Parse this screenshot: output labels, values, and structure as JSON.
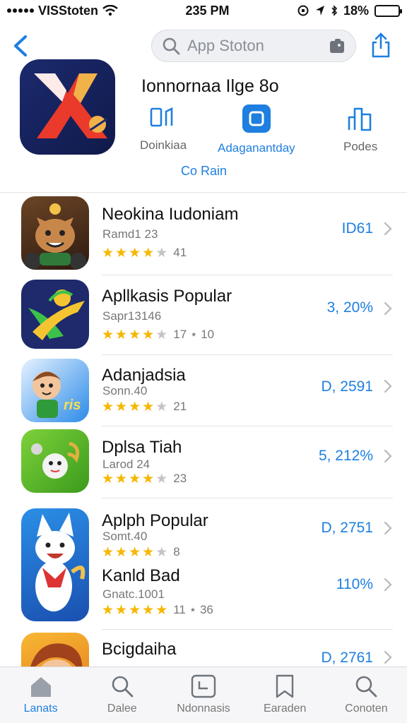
{
  "status_bar": {
    "carrier": "VISStoten",
    "time": "235 PM",
    "battery": "18%"
  },
  "nav": {
    "search_placeholder": "App Stoton"
  },
  "header": {
    "title": "Ionnornaa Ilge 8o",
    "actions": [
      {
        "label": "Doinkiaa",
        "icon": "chart-icon"
      },
      {
        "label": "Adaganantday",
        "icon": "app-square-icon",
        "active": true
      },
      {
        "label": "Podes",
        "icon": "bar-chart-icon"
      }
    ],
    "link": "Co Rain"
  },
  "list": [
    {
      "name": "Neokina Iudoniam",
      "sub": "Ramd1 23",
      "rating": 4,
      "count": "41",
      "value": "ID61"
    },
    {
      "name": "Apllkasis Popular",
      "sub": "Sapr13146",
      "rating": 3.5,
      "count": "17 ⋆ 10",
      "value": "3, 20%"
    },
    {
      "name": "Adanjadsia",
      "sub": "Sonn.40",
      "rating": 4,
      "count": "21",
      "value": "D, 2591"
    },
    {
      "name": "Dplsa Tiah",
      "sub": "Larod 24",
      "rating": 4,
      "count": "23",
      "value": "5, 212%"
    },
    {
      "name": "Aplph Popular",
      "sub": "Somt.40",
      "rating": 4,
      "count": "8",
      "value": "D, 2751"
    },
    {
      "name": "Kanld Bad",
      "sub": "Gnatc.1001",
      "rating": 5,
      "count": "11 ⋆ 36",
      "value": "110%"
    },
    {
      "name": "Bcigdaiha",
      "sub": "",
      "rating": 0,
      "count": "",
      "value": "D, 2761"
    }
  ],
  "tabs": [
    {
      "label": "Lanats",
      "icon": "home-icon",
      "active": true
    },
    {
      "label": "Dalee",
      "icon": "search-icon"
    },
    {
      "label": "Ndonnasis",
      "icon": "calendar-icon"
    },
    {
      "label": "Earaden",
      "icon": "bookmark-icon"
    },
    {
      "label": "Conoten",
      "icon": "search-icon"
    }
  ],
  "colors": {
    "accent": "#1e7fe0",
    "star": "#f6b700"
  }
}
